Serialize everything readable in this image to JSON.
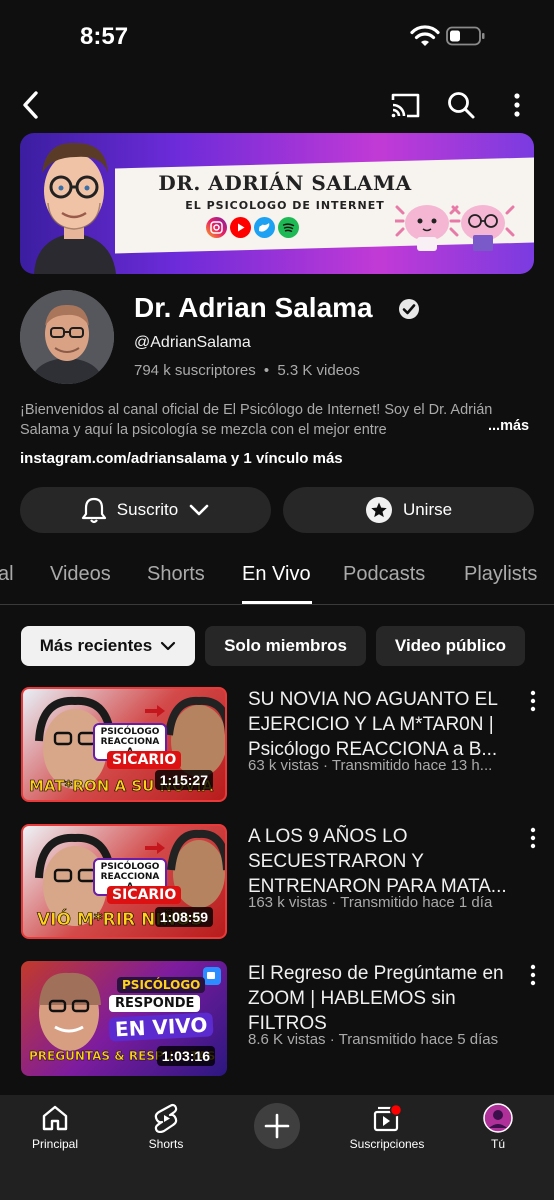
{
  "status_bar": {
    "time": "8:57",
    "icons": [
      "wifi-icon",
      "battery-icon"
    ]
  },
  "top_bar": {
    "icons": [
      "back-icon",
      "cast-icon",
      "search-icon",
      "more-vertical-icon"
    ]
  },
  "banner": {
    "title": "DR. ADRIÁN SALAMA",
    "subtitle": "EL PSICOLOGO DE INTERNET",
    "socials": [
      "instagram-icon",
      "youtube-icon",
      "twitter-icon",
      "spotify-icon"
    ]
  },
  "channel": {
    "name": "Dr. Adrian Salama",
    "handle": "@AdrianSalama",
    "subscribers": "794 k suscriptores",
    "separator": "•",
    "videos": "5.3 K videos",
    "description": "¡Bienvenidos al canal oficial de El Psicólogo de Internet! Soy el Dr. Adrián Salama y aquí la psicología se mezcla con el mejor entre",
    "more_label": "...más",
    "links": "instagram.com/adriansalama y 1 vínculo más"
  },
  "actions": {
    "subscribed_label": "Suscrito",
    "join_label": "Unirse"
  },
  "tabs": [
    {
      "label": "al",
      "active": false
    },
    {
      "label": "Videos",
      "active": false
    },
    {
      "label": "Shorts",
      "active": false
    },
    {
      "label": "En Vivo",
      "active": true
    },
    {
      "label": "Podcasts",
      "active": false
    },
    {
      "label": "Playlists",
      "active": false
    }
  ],
  "chips": [
    {
      "label": "Más recientes",
      "selected": true
    },
    {
      "label": "Solo miembros",
      "selected": false
    },
    {
      "label": "Video público",
      "selected": false
    }
  ],
  "videos": [
    {
      "title": "SU NOVIA NO AGUANTO EL EJERCICIO Y LA M*TAR0N | Psicólogo REACCIONA a B...",
      "meta": "63 k vistas · Transmitido hace 13 h...",
      "duration": "1:15:27",
      "thumb_badge": "PSICÓLOGO REACCIONA A",
      "thumb_tag": "SICARIO",
      "thumb_caption": "MAT*RON A SU NOVIA"
    },
    {
      "title": "A LOS 9 AÑOS LO SECUESTRARON Y ENTRENARON PARA MATA...",
      "meta": "163 k vistas · Transmitido hace 1 día",
      "duration": "1:08:59",
      "thumb_badge": "PSICÓLOGO REACCIONA A",
      "thumb_tag": "SICARIO",
      "thumb_caption": "VIÓ M*RIR NIÑOS"
    },
    {
      "title": "El Regreso de Pregúntame en ZOOM | HABLEMOS sin FILTROS",
      "meta": "8.6 K vistas · Transmitido hace 5 días",
      "duration": "1:03:16",
      "thumb_badge": "PSICÓLOGO",
      "thumb_tag": "RESPONDE",
      "thumb_caption": "EN VIVO",
      "thumb_footer": "PREGUNTAS & RESPUESTAS"
    }
  ],
  "bottom_nav": [
    {
      "label": "Principal",
      "icon": "home-icon"
    },
    {
      "label": "Shorts",
      "icon": "shorts-icon"
    },
    {
      "label": "",
      "icon": "create-plus-icon"
    },
    {
      "label": "Suscripciones",
      "icon": "subscriptions-icon"
    },
    {
      "label": "Tú",
      "icon": "profile-avatar-icon"
    }
  ],
  "colors": {
    "background": "#0f0f0f",
    "surface": "#272727",
    "muted_text": "#aaaaaa",
    "accent_red": "#ff0000"
  }
}
